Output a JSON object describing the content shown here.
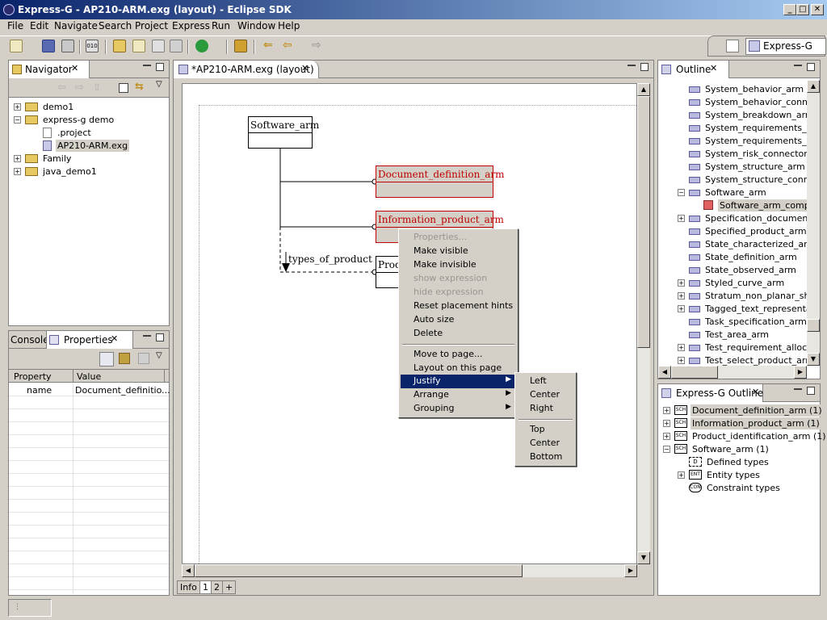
{
  "window": {
    "title": "Express-G - AP210-ARM.exg (layout) - Eclipse SDK"
  },
  "menu": [
    "File",
    "Edit",
    "Navigate",
    "Search",
    "Project",
    "Express",
    "Run",
    "Window",
    "Help"
  ],
  "perspective": {
    "label": "Express-G"
  },
  "navigator": {
    "title": "Navigator",
    "items": [
      {
        "label": "demo1"
      },
      {
        "label": "express-g demo"
      },
      {
        "label": ".project"
      },
      {
        "label": "AP210-ARM.exg"
      },
      {
        "label": "Family"
      },
      {
        "label": "java_demo1"
      }
    ]
  },
  "bottom_left": {
    "tab_console": "Console",
    "tab_properties": "Properties",
    "columns": [
      "Property",
      "Value"
    ],
    "rows": [
      {
        "property": "name",
        "value": "Document_definitio..."
      }
    ]
  },
  "editor": {
    "tab": "*AP210-ARM.exg (layout)",
    "boxes": {
      "software": "Software_arm",
      "document": "Document_definition_arm",
      "information": "Information_product_arm",
      "product": "Prod"
    },
    "relation_label": "types_of_product",
    "bottom_tabs": [
      "Info",
      "1",
      "2",
      "+"
    ]
  },
  "context_menu": {
    "items": [
      {
        "label": "Properties...",
        "disabled": true
      },
      {
        "label": "Make visible",
        "disabled": false
      },
      {
        "label": "Make invisible",
        "disabled": false
      },
      {
        "label": "show expression",
        "disabled": true
      },
      {
        "label": "hide expression",
        "disabled": true
      },
      {
        "label": "Reset placement hints",
        "disabled": false
      },
      {
        "label": "Auto size",
        "disabled": false
      },
      {
        "label": "Delete",
        "disabled": false
      },
      {
        "label": "Move to page...",
        "disabled": false
      },
      {
        "label": "Layout on this page",
        "disabled": false
      },
      {
        "label": "Justify",
        "disabled": false
      },
      {
        "label": "Arrange",
        "disabled": false
      },
      {
        "label": "Grouping",
        "disabled": false
      }
    ],
    "submenu": [
      "Left",
      "Center",
      "Right",
      "Top",
      "Center",
      "Bottom"
    ]
  },
  "outline": {
    "title": "Outline",
    "items": [
      "System_behavior_arm",
      "System_behavior_connec",
      "System_breakdown_arm",
      "System_requirements_arr",
      "System_requirements_co",
      "System_risk_connector_a",
      "System_structure_arm",
      "System_structure_conne",
      "Software_arm",
      "Software_arm_comple",
      "Specification_document_a",
      "Specified_product_arm",
      "State_characterized_arm",
      "State_definition_arm",
      "State_observed_arm",
      "Styled_curve_arm",
      "Stratum_non_planar_sha",
      "Tagged_text_representa",
      "Task_specification_arm",
      "Test_area_arm",
      "Test_requirement_allocat",
      "Test_select_product_arm"
    ]
  },
  "expressg_outline": {
    "title": "Express-G Outline",
    "items": [
      {
        "label": "Document_definition_arm (1)",
        "icon": "SCH"
      },
      {
        "label": "Information_product_arm (1)",
        "icon": "SCH"
      },
      {
        "label": "Product_identification_arm (1)",
        "icon": "SCH"
      },
      {
        "label": "Software_arm (1)",
        "icon": "SCH"
      },
      {
        "label": "Defined types",
        "icon": "D"
      },
      {
        "label": "Entity types",
        "icon": "ENT"
      },
      {
        "label": "Constraint types",
        "icon": "CON"
      }
    ]
  },
  "colors": {
    "title_start": "#0a246a",
    "title_end": "#a6caf0",
    "highlight": "#0a246a",
    "red_entity": "#c00000"
  }
}
